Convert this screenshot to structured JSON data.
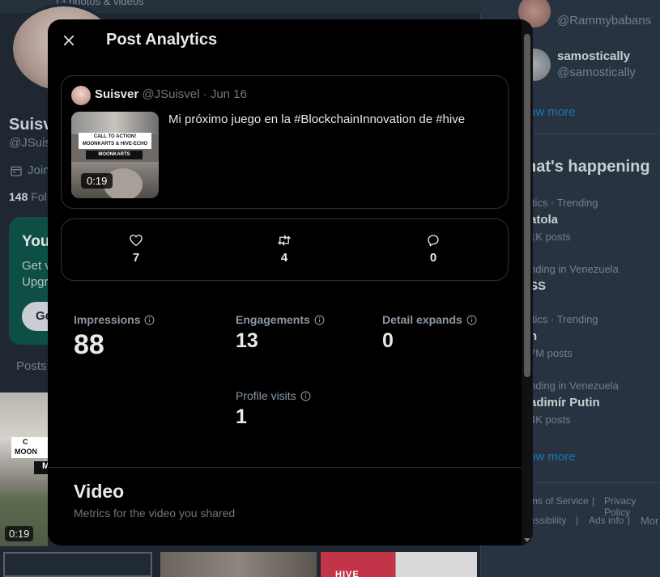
{
  "background": {
    "photos_caption": "13 photos & videos",
    "profile_name": "Suisv",
    "profile_handle": "@JSuis",
    "joined": "Join",
    "followers": "148",
    "followers_label": "Fol",
    "premium_title": "You",
    "premium_line1": "Get v",
    "premium_line2": "Upgr",
    "premium_button": "Ge",
    "posts_tab": "Posts",
    "grid_durations": [
      "0:19"
    ],
    "grid_text": [
      "C",
      "MOON",
      "M"
    ],
    "grid_label_hive": "HIVE",
    "sidebar": {
      "users": [
        {
          "name": "",
          "handle": "@Rammybabans"
        },
        {
          "name": "samostically",
          "handle": "@samostically"
        }
      ],
      "show_more": "ow more",
      "whats_happening": "hat's happening",
      "trends": [
        {
          "meta": "itics · Trending",
          "name": "atola",
          "count": "1K posts"
        },
        {
          "meta": "nding in Venezuela",
          "name": "SS",
          "count": ""
        },
        {
          "meta": "itics · Trending",
          "name": "n",
          "count": "7M posts"
        },
        {
          "meta": "nding in Venezuela",
          "name": "adimír Putin",
          "count": "4K posts"
        }
      ],
      "show_more_2": "ow more",
      "footer": [
        "ms of Service",
        "Privacy Policy",
        "essibility",
        "Ads info",
        "Mor"
      ]
    }
  },
  "modal": {
    "title": "Post Analytics",
    "tweet": {
      "name": "Suisver",
      "handle": "@JSuisvel",
      "separator": "·",
      "date": "Jun 16",
      "text": "Mi próximo juego en la #BlockchainInnovation de #hive",
      "thumb_banner": "CALL TO ACTION! MOONKARTS & HIVE-ECHO",
      "thumb_label": "MOONKARTS",
      "duration": "0:19"
    },
    "stats": {
      "likes": "7",
      "reposts": "4",
      "replies": "0"
    },
    "metrics": {
      "impressions": {
        "label": "Impressions",
        "value": "88"
      },
      "engagements": {
        "label": "Engagements",
        "value": "13"
      },
      "detail_expands": {
        "label": "Detail expands",
        "value": "0"
      },
      "profile_visits": {
        "label": "Profile visits",
        "value": "1"
      }
    },
    "video": {
      "title": "Video",
      "subtitle": "Metrics for the video you shared"
    }
  },
  "colors": {
    "modal_bg": "#000000",
    "page_bg": "#1e2732",
    "text_primary": "#e7e9ea",
    "text_secondary": "#71767b",
    "border": "#2f3336"
  },
  "icons": [
    "close-icon",
    "heart-icon",
    "repost-icon",
    "reply-icon",
    "info-icon",
    "calendar-icon"
  ]
}
